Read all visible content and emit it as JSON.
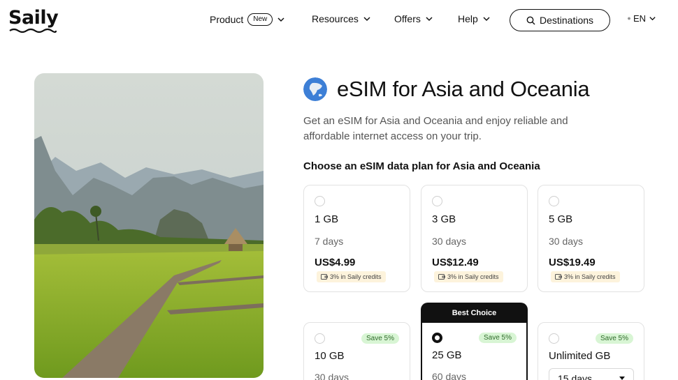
{
  "header": {
    "logo": "Saily",
    "nav": [
      {
        "label": "Product",
        "badge": "New"
      },
      {
        "label": "Resources"
      },
      {
        "label": "Offers"
      },
      {
        "label": "Help"
      }
    ],
    "destinations_label": "Destinations",
    "language": "EN"
  },
  "hero": {
    "title": "eSIM for Asia and Oceania",
    "subtitle": "Get an eSIM for Asia and Oceania and enjoy reliable and affordable internet access on your trip.",
    "plan_heading": "Choose an eSIM data plan for Asia and Oceania"
  },
  "plans": [
    {
      "data": "1 GB",
      "days": "7 days",
      "price": "US$4.99",
      "credit": "3% in Saily credits",
      "selected": false
    },
    {
      "data": "3 GB",
      "days": "30 days",
      "price": "US$12.49",
      "credit": "3% in Saily credits",
      "selected": false
    },
    {
      "data": "5 GB",
      "days": "30 days",
      "price": "US$19.49",
      "credit": "3% in Saily credits",
      "selected": false
    },
    {
      "data": "10 GB",
      "days": "30 days",
      "save": "Save 5%",
      "selected": false
    },
    {
      "data": "25 GB",
      "days": "60 days",
      "save": "Save 5%",
      "selected": true,
      "tag": "Best Choice"
    },
    {
      "data": "Unlimited GB",
      "days": "15 days",
      "save": "Save 5%",
      "selected": false
    }
  ],
  "colors": {
    "text": "#111111",
    "muted": "#555555",
    "credit_bg": "#fdf3dc",
    "save_bg": "#d8f5d4",
    "save_text": "#2f6b2a"
  }
}
